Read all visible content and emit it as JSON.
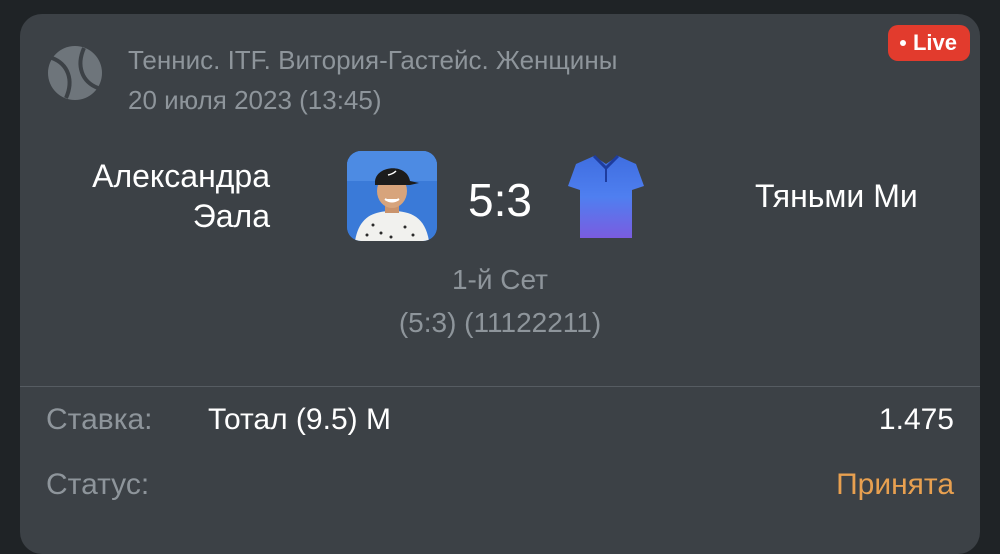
{
  "header": {
    "sport_icon": "tennis-ball-icon",
    "tournament": "Теннис. ITF. Витория-Гастейс. Женщины",
    "date": "20 июля 2023 (13:45)",
    "live_label": "Live"
  },
  "match": {
    "player_left": {
      "first_name": "Александра",
      "last_name": "Эала",
      "avatar_icon": "player-photo"
    },
    "player_right": {
      "name": "Тяньми Ми",
      "avatar_icon": "blue-shirt-icon"
    },
    "score": "5:3",
    "set_label": "1-й Сет",
    "set_detail": "(5:3)  (11122211)"
  },
  "bet": {
    "label": "Ставка:",
    "value": "Тотал (9.5) М",
    "odds": "1.475"
  },
  "status": {
    "label": "Статус:",
    "value": "Принята"
  },
  "colors": {
    "card_bg": "#3c4146",
    "live_badge": "#e23b2d",
    "status_accepted": "#e8a050",
    "muted_text": "#8e959b"
  }
}
